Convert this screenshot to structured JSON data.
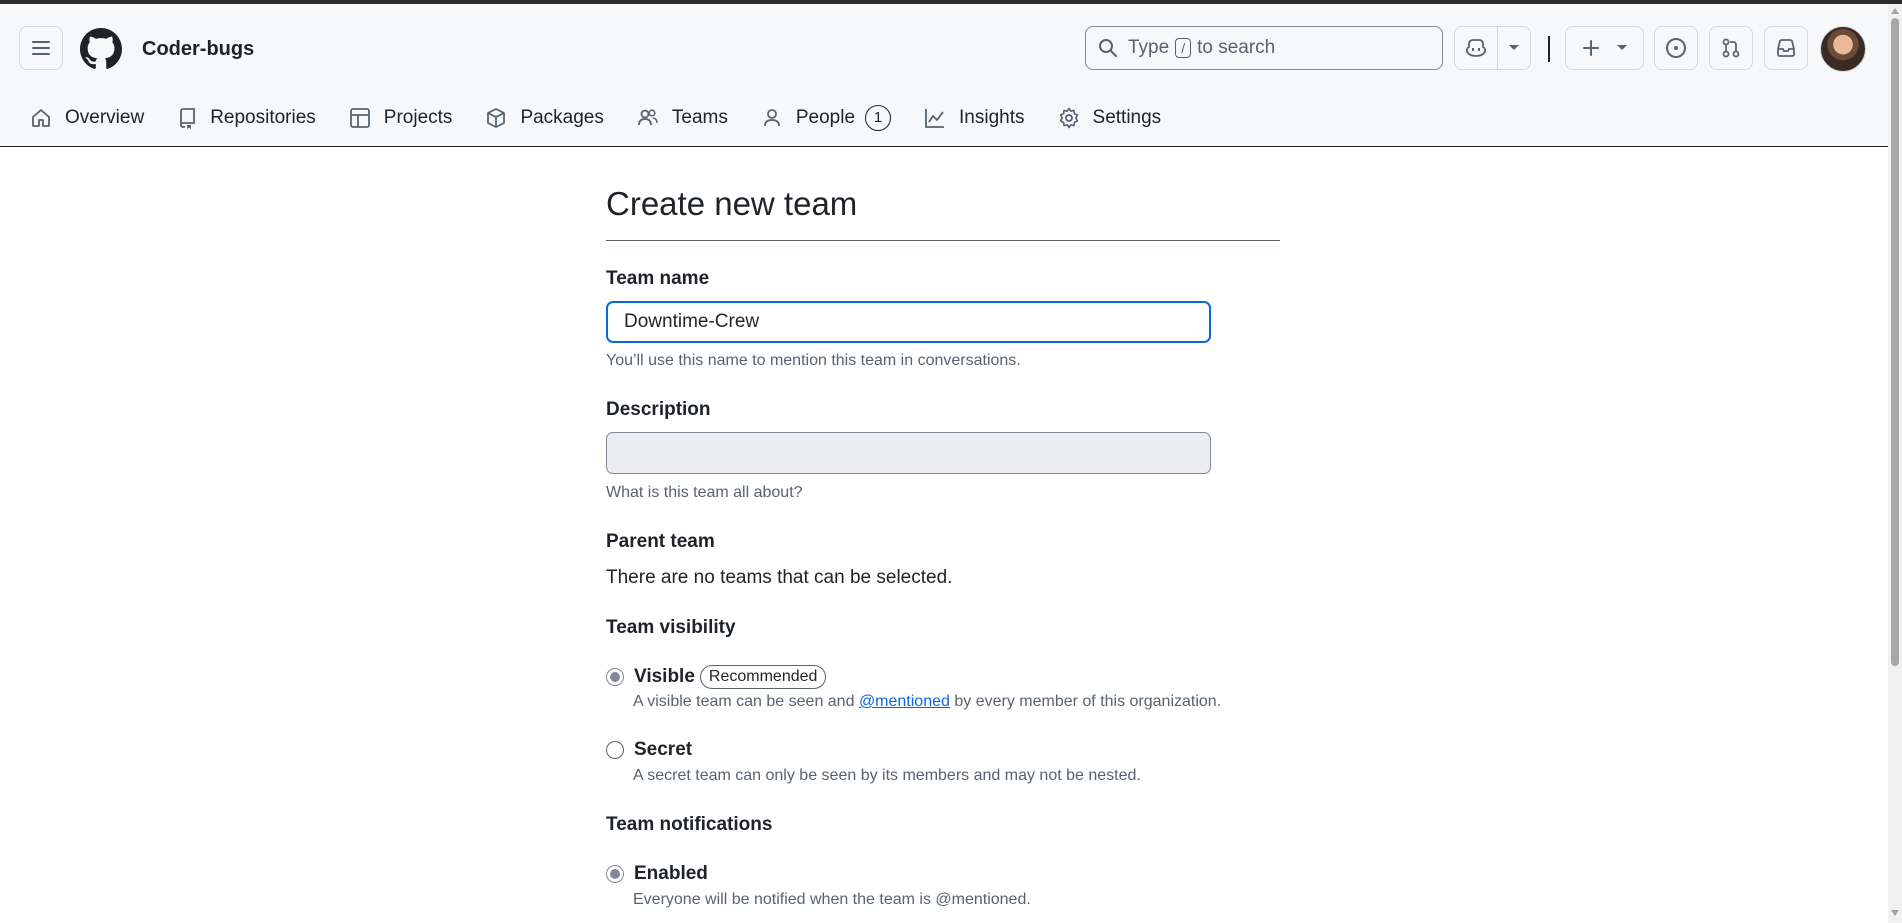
{
  "header": {
    "org_name": "Coder-bugs",
    "search": {
      "prefix": "Type",
      "key": "/",
      "suffix": "to search"
    },
    "colors": {
      "header_bg": "#f6f8fa",
      "accent": "#0969da",
      "text": "#1f2328",
      "muted": "#59636e"
    }
  },
  "nav": {
    "items": [
      {
        "label": "Overview",
        "icon": "home-icon"
      },
      {
        "label": "Repositories",
        "icon": "repo-icon"
      },
      {
        "label": "Projects",
        "icon": "table-icon"
      },
      {
        "label": "Packages",
        "icon": "package-icon"
      },
      {
        "label": "Teams",
        "icon": "people-icon"
      },
      {
        "label": "People",
        "icon": "person-icon",
        "count": "1"
      },
      {
        "label": "Insights",
        "icon": "graph-icon"
      },
      {
        "label": "Settings",
        "icon": "gear-icon"
      }
    ]
  },
  "form": {
    "title": "Create new team",
    "team_name": {
      "label": "Team name",
      "value": "Downtime-Crew",
      "hint": "You’ll use this name to mention this team in conversations."
    },
    "description": {
      "label": "Description",
      "value": "",
      "hint": "What is this team all about?"
    },
    "parent_team": {
      "label": "Parent team",
      "text": "There are no teams that can be selected."
    },
    "visibility": {
      "label": "Team visibility",
      "options": [
        {
          "label": "Visible",
          "badge": "Recommended",
          "desc_before": "A visible team can be seen and",
          "desc_link": "@mentioned",
          "desc_after": "by every member of this organization.",
          "checked": true
        },
        {
          "label": "Secret",
          "desc": "A secret team can only be seen by its members and may not be nested.",
          "checked": false
        }
      ]
    },
    "notifications": {
      "label": "Team notifications",
      "options": [
        {
          "label": "Enabled",
          "desc": "Everyone will be notified when the team is @mentioned.",
          "checked": true
        }
      ]
    }
  }
}
